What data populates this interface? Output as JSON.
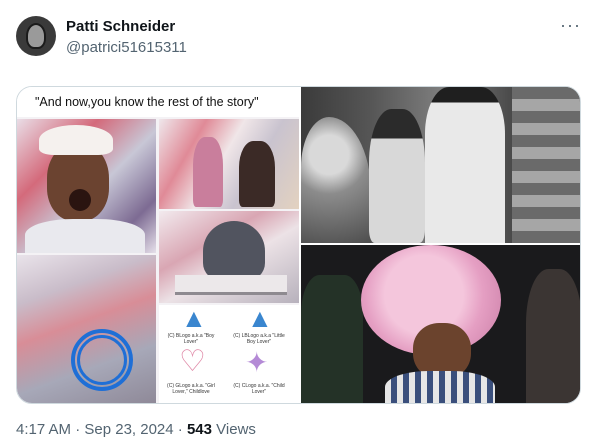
{
  "post": {
    "author_name": "Patti Schneider",
    "author_handle": "@patrici51615311",
    "more_icon": "more-horizontal-icon",
    "timestamp": "4:17 AM · Sep 23, 2024",
    "views_sep": " · ",
    "views_count": "543",
    "views_label": " Views"
  },
  "media": {
    "collage_caption": "\"And now,you know the rest of the story\"",
    "symbol_captions": [
      "(C) BLogo a.k.a \"Boy Lover\"",
      "(C) LBLogo a.k.a \"Little Boy Lover\"",
      "(C) GLogo a.k.a. \"Girl Lover,\" Childlove",
      "(C) CLogo a.k.a. \"Child Lover\""
    ]
  },
  "colors": {
    "text_primary": "#0f1419",
    "text_secondary": "#536471",
    "border": "#cfd9de",
    "circle_annotation": "#1f6fd6"
  }
}
